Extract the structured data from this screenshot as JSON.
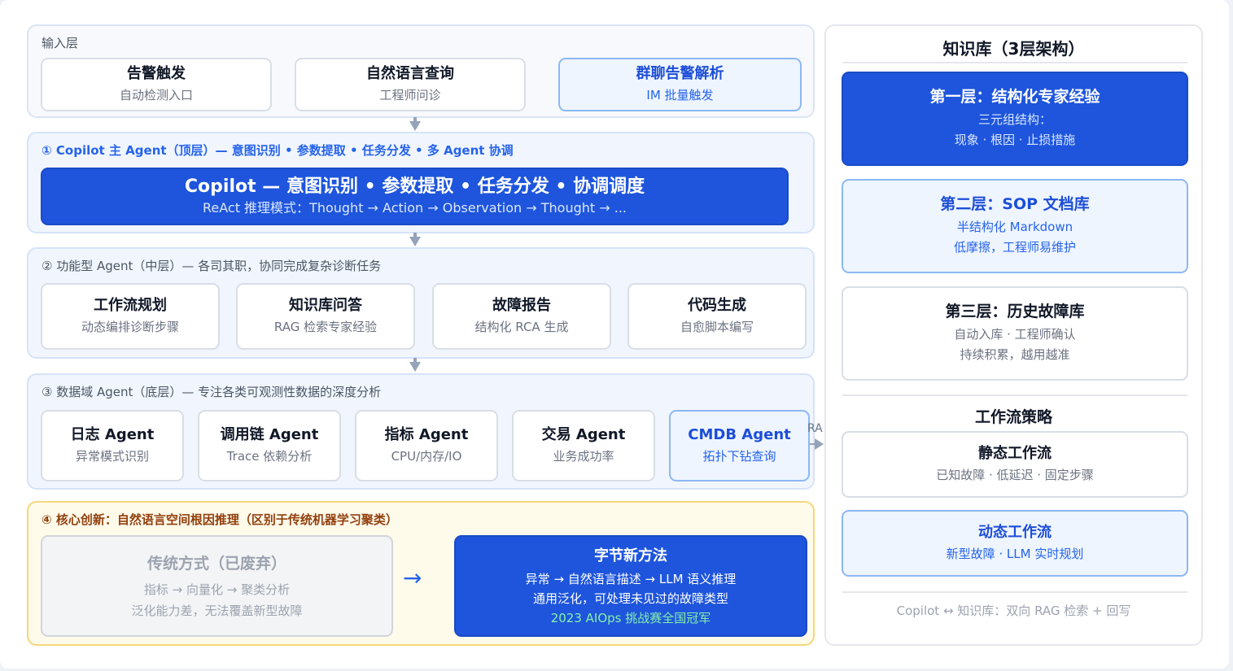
{
  "input_layer": {
    "label": "输入层",
    "cards": [
      {
        "title": "告警触发",
        "sub": "自动检测入口"
      },
      {
        "title": "自然语言查询",
        "sub": "工程师问诊"
      },
      {
        "title": "群聊告警解析",
        "sub": "IM 批量触发"
      }
    ]
  },
  "top_layer": {
    "label": "① Copilot 主 Agent（顶层）— 意图识别 • 参数提取 • 任务分发 • 多 Agent 协调",
    "banner_title": "Copilot — 意图识别 • 参数提取 • 任务分发 • 协调调度",
    "banner_sub": "ReAct 推理模式：Thought → Action → Observation → Thought → ..."
  },
  "mid_layer": {
    "label": "② 功能型 Agent（中层）— 各司其职，协同完成复杂诊断任务",
    "cards": [
      {
        "title": "工作流规划",
        "sub": "动态编排诊断步骤"
      },
      {
        "title": "知识库问答",
        "sub": "RAG 检索专家经验"
      },
      {
        "title": "故障报告",
        "sub": "结构化 RCA 生成"
      },
      {
        "title": "代码生成",
        "sub": "自愈脚本编写"
      }
    ]
  },
  "data_layer": {
    "label": "③ 数据域 Agent（底层）— 专注各类可观测性数据的深度分析",
    "cards": [
      {
        "title": "日志 Agent",
        "sub": "异常模式识别"
      },
      {
        "title": "调用链 Agent",
        "sub": "Trace 依赖分析"
      },
      {
        "title": "指标 Agent",
        "sub": "CPU/内存/IO"
      },
      {
        "title": "交易 Agent",
        "sub": "业务成功率"
      },
      {
        "title": "CMDB Agent",
        "sub": "拓扑下钻查询"
      }
    ],
    "connector_label": "RA"
  },
  "innovation": {
    "label": "④ 核心创新：自然语言空间根因推理（区别于传统机器学习聚类）",
    "old_title": "传统方式（已废弃）",
    "old_line1": "指标 → 向量化 → 聚类分析",
    "old_line2": "泛化能力差，无法覆盖新型故障",
    "arrow": "→",
    "new_title": "字节新方法",
    "new_line1": "异常 → 自然语言描述 → LLM 语义推理",
    "new_line2": "通用泛化，可处理未见过的故障类型",
    "new_line3": "2023 AIOps 挑战赛全国冠军"
  },
  "knowledge": {
    "title": "知识库（3层架构）",
    "layers": [
      {
        "title": "第一层：结构化专家经验",
        "line1": "三元组结构：",
        "line2": "现象 · 根因 · 止损措施"
      },
      {
        "title": "第二层：SOP 文档库",
        "line1": "半结构化 Markdown",
        "line2": "低摩擦，工程师易维护"
      },
      {
        "title": "第三层：历史故障库",
        "line1": "自动入库 · 工程师确认",
        "line2": "持续积累，越用越准"
      }
    ]
  },
  "workflow": {
    "title": "工作流策略",
    "items": [
      {
        "title": "静态工作流",
        "sub": "已知故障 · 低延迟 · 固定步骤"
      },
      {
        "title": "动态工作流",
        "sub": "新型故障 · LLM 实时规划"
      }
    ]
  },
  "footer": "Copilot ↔ 知识库：双向 RAG 检索 + 回写",
  "colors": {
    "primary_blue": "#1e55dc",
    "accent_green": "#86efac",
    "innovation_border": "#f6d67a"
  }
}
